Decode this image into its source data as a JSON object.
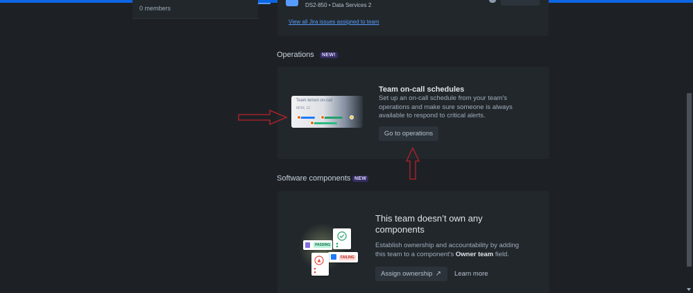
{
  "sidebar": {
    "members_text": "0 members"
  },
  "jira": {
    "issue_text": "DS2-850 • Data Services 2",
    "view_all_link": "View all Jira issues assigned to team"
  },
  "operations": {
    "heading": "Operations",
    "badge": "NEW!",
    "illustration": {
      "title": "Team lemon on-call",
      "date": "MON, 12"
    },
    "card_title": "Team on-call schedules",
    "card_desc": "Set up an on-call schedule from your team's operations and make sure someone is always available to respond to critical alerts.",
    "button_label": "Go to operations"
  },
  "software": {
    "heading": "Software components",
    "badge": "NEW",
    "illustration": {
      "pass_label": "PASSING",
      "fail_label": "FAILING"
    },
    "title": "This team doesn’t own any components",
    "desc_prefix": "Establish ownership and accountability by adding this team to a component's ",
    "desc_bold": "Owner team",
    "desc_suffix": " field.",
    "assign_label": "Assign ownership",
    "assign_icon": "↗",
    "learn_more": "Learn more"
  },
  "colors": {
    "accent": "#0c66e4",
    "annotation": "#b8212a",
    "background": "#1d2125",
    "card": "#22272b"
  }
}
